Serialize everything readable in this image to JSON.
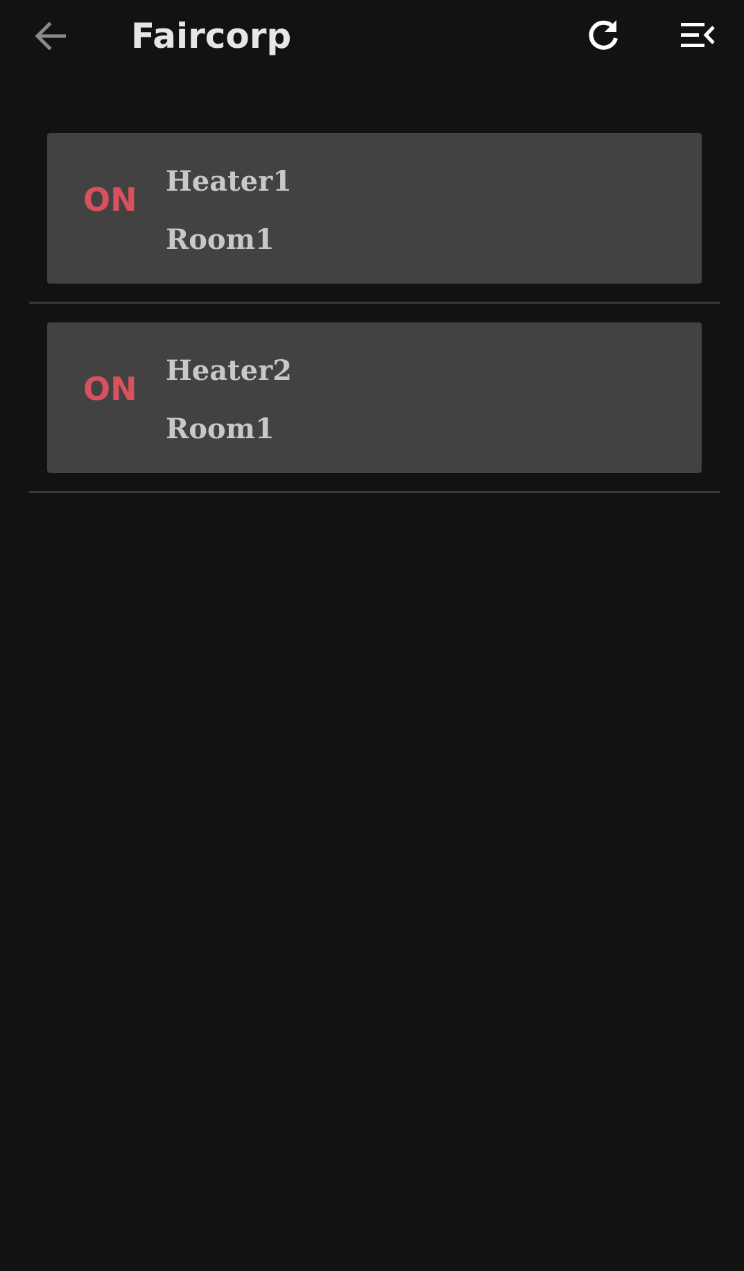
{
  "app_bar": {
    "title": "Faircorp",
    "back_icon": "arrow-back-icon",
    "refresh_icon": "refresh-icon",
    "menu_icon": "menu-open-icon"
  },
  "colors": {
    "background": "#121212",
    "card": "#424242",
    "status_on": "#d9505f",
    "text": "#c8c8c8"
  },
  "heaters": [
    {
      "status": "ON",
      "name": "Heater1",
      "room": "Room1"
    },
    {
      "status": "ON",
      "name": "Heater2",
      "room": "Room1"
    }
  ]
}
